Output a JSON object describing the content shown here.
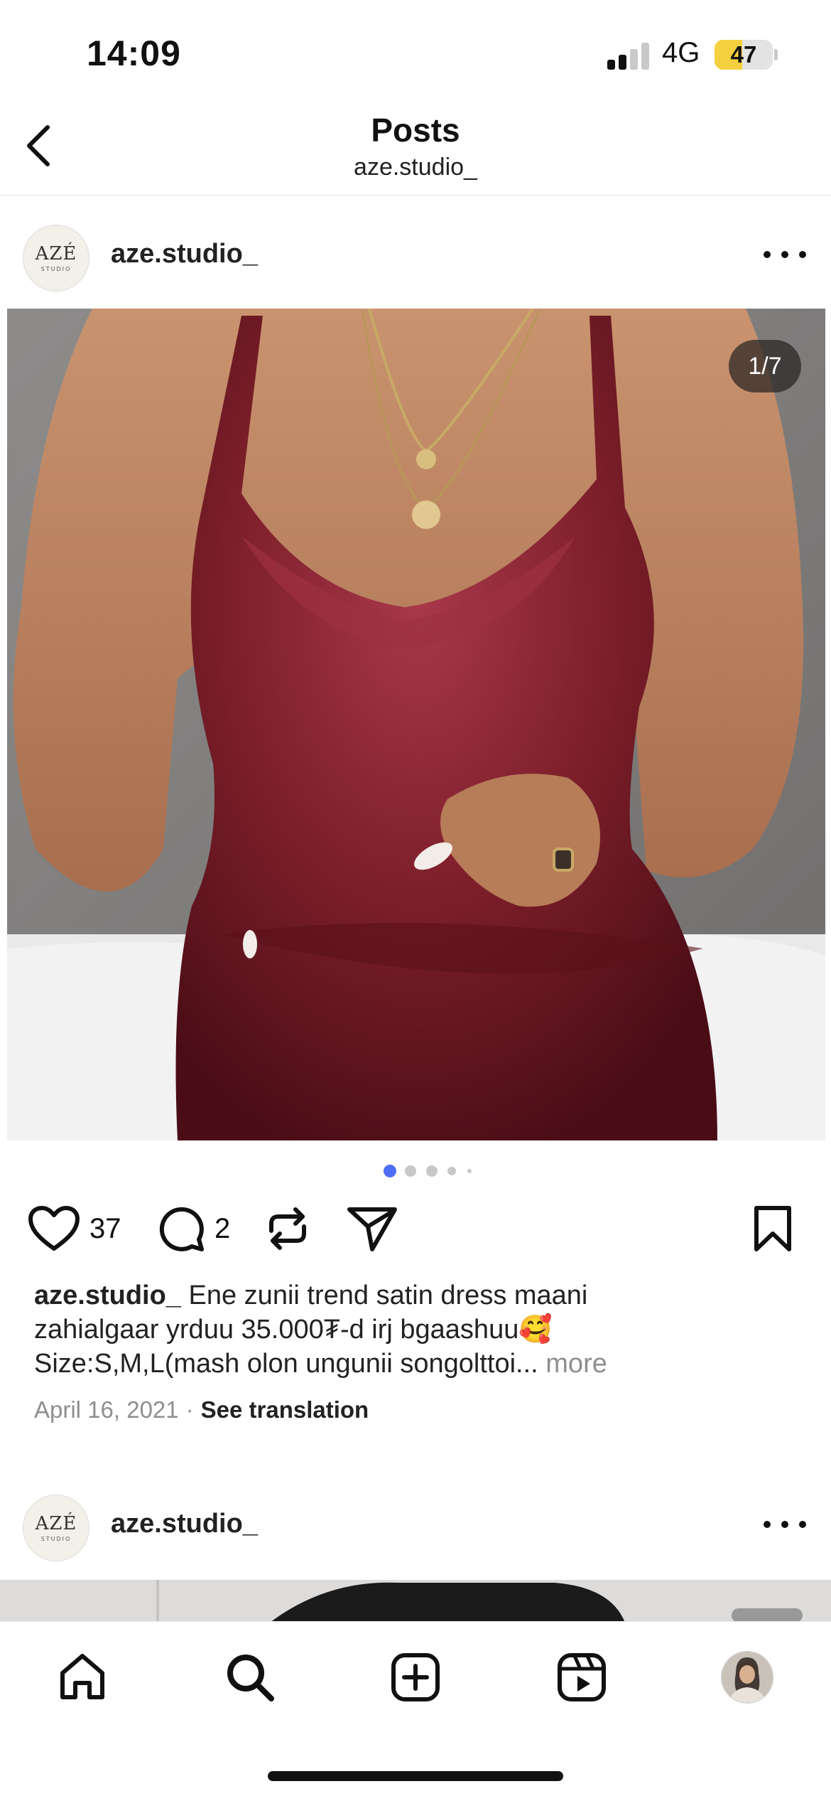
{
  "status": {
    "time": "14:09",
    "network": "4G",
    "battery": "47",
    "battery_level": 0.47
  },
  "header": {
    "title": "Posts",
    "subtitle": "aze.studio_",
    "back_icon": "chevron-left-icon"
  },
  "posts": [
    {
      "username": "aze.studio_",
      "avatar_logo": "AZÉ",
      "avatar_logo_sub": "STUDIO",
      "counter": "1/7",
      "likes": "37",
      "comments": "2",
      "caption_user": "aze.studio_",
      "caption_line1": "Ene zunii trend satin dress maani",
      "caption_line2": "zahialgaar yrduu 35.000₮-d irj bgaashuu🥰",
      "caption_line3": "Size:S,M,L(mash olon ungunii songolttoi...",
      "more_label": "more",
      "date": "April 16, 2021",
      "separator": "·",
      "translate_label": "See translation"
    },
    {
      "username": "aze.studio_",
      "avatar_logo": "AZÉ",
      "avatar_logo_sub": "STUDIO"
    }
  ],
  "tab_bar": {
    "items": [
      "home-icon",
      "search-icon",
      "create-icon",
      "reels-icon",
      "profile-avatar"
    ]
  },
  "colors": {
    "dot_active": "#4f6ef7",
    "dot_inactive": "#c8c8c8",
    "battery_fill": "#f4d03f",
    "dress": "#7d1f2a"
  }
}
